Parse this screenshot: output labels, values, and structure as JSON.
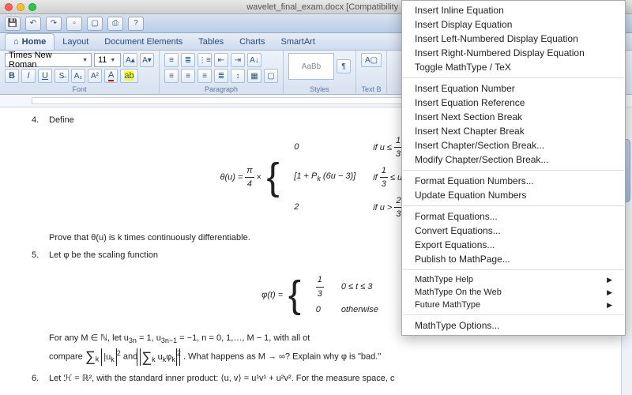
{
  "window": {
    "title": "wavelet_final_exam.docx [Compatibility Mode]"
  },
  "tabs": {
    "home": "Home",
    "layout": "Layout",
    "docel": "Document Elements",
    "tables": "Tables",
    "charts": "Charts",
    "smartart": "SmartArt"
  },
  "ribbon": {
    "font_group": "Font",
    "para_group": "Paragraph",
    "styles_group": "Styles",
    "font_name": "Times New Roman",
    "font_size": "11",
    "styles_label": "Styles",
    "textbox_label": "Text B"
  },
  "doc": {
    "n4": "4.",
    "define": "Define",
    "theta_lhs": "θ(u) =",
    "pi": "π",
    "four": "4",
    "times": "×",
    "r1a": "0",
    "r1b": "if u ≤",
    "f13n": "1",
    "f13d": "3",
    "r2a": "1 + P",
    "r2k": "k",
    "r2a2": "(6u − 3)",
    "r2b": "if ",
    "r2b2": " ≤ u ≤ ",
    "f23n": "2",
    "f23d": "3",
    "r3a": "2",
    "r3b": "if u > ",
    "prove": "Prove that θ(u) is k times continuously differentiable.",
    "n5": "5.",
    "let_phi": "Let φ be the scaling function",
    "phi_lhs": "φ(t) =",
    "p1a": "",
    "p1n": "1",
    "p1d": "3",
    "p1b": "0 ≤ t ≤ 3",
    "p2a": "0",
    "p2b": "otherwise",
    "forany": "For any M ∈ ℕ, let u",
    "forany_sub1": "3n",
    "forany_mid": " = 1, u",
    "forany_sub2": "3n−1",
    "forany_tail": " = −1, n = 0, 1,…, M − 1, with all ot",
    "compare": "compare ",
    "sum1_sub": "k",
    "sum1_body": "|u",
    "sum1_bsub": "k",
    "sum1_tail": "|",
    "sum1_sup": "2",
    "and": " and ",
    "sum2_body": "u",
    "sum2_bsub": "k",
    "sum2_phi": "φ",
    "sum2_psub": "k",
    "sum2_sup": "2",
    "whath": ". What happens as M → ∞? Explain why φ is \"bad.\"",
    "n6": "6.",
    "let_h": "Let ℋ = ℝ², with the standard inner product: ⟨u, v⟩ = u¹v¹ + u²v². For the measure space, c"
  },
  "menu": {
    "items1": [
      "Insert Inline Equation",
      "Insert Display Equation",
      "Insert Left-Numbered Display Equation",
      "Insert Right-Numbered Display Equation",
      "Toggle MathType / TeX"
    ],
    "items2": [
      "Insert Equation Number",
      "Insert Equation Reference",
      "Insert Next Section Break",
      "Insert Next Chapter Break",
      "Insert Chapter/Section Break...",
      "Modify Chapter/Section Break..."
    ],
    "items3": [
      "Format Equation Numbers...",
      "Update Equation Numbers"
    ],
    "items4": [
      "Format Equations...",
      "Convert Equations...",
      "Export Equations...",
      "Publish to MathPage..."
    ],
    "items5": [
      "MathType Help",
      "MathType On the Web",
      "Future MathType"
    ],
    "items6": [
      "MathType Options..."
    ]
  }
}
